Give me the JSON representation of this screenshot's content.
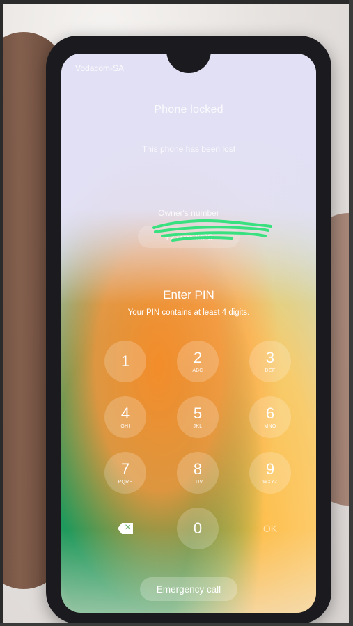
{
  "status_bar": {
    "carrier": "Vodacom-SA"
  },
  "lock_screen": {
    "title": "Phone locked",
    "message": "This phone has been lost",
    "owner_label": "Owner's number",
    "owner_number": "+27••••3020",
    "prompt": "Enter PIN",
    "hint": "Your PIN contains at least 4 digits."
  },
  "keypad": {
    "keys": [
      {
        "digit": "1",
        "letters": ""
      },
      {
        "digit": "2",
        "letters": "ABC"
      },
      {
        "digit": "3",
        "letters": "DEF"
      },
      {
        "digit": "4",
        "letters": "GHI"
      },
      {
        "digit": "5",
        "letters": "JKL"
      },
      {
        "digit": "6",
        "letters": "MNO"
      },
      {
        "digit": "7",
        "letters": "PQRS"
      },
      {
        "digit": "8",
        "letters": "TUV"
      },
      {
        "digit": "9",
        "letters": "WXYZ"
      },
      {
        "digit": "0",
        "letters": ""
      }
    ],
    "ok_label": "OK"
  },
  "emergency": {
    "label": "Emergency call"
  },
  "colors": {
    "overlay_text": "#ffffff",
    "keypad_button_bg": "rgba(255,255,255,0.20)",
    "scribble": "#39e07f"
  }
}
